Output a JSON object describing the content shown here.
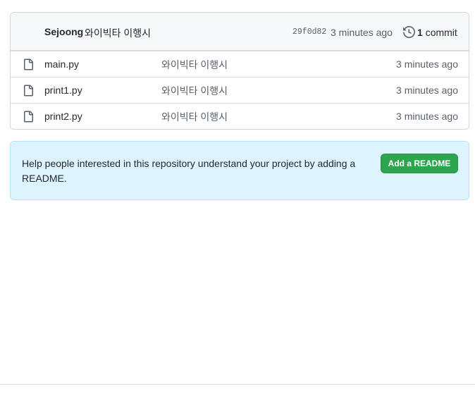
{
  "latest_commit": {
    "author": "Sejoong",
    "message": "와이빅타 이행시",
    "sha": "29f0d82",
    "time": "3 minutes ago",
    "commit_count": "1",
    "commit_label": "commit",
    "history_icon": "history-icon"
  },
  "files": [
    {
      "name": "main.py",
      "message": "와이빅타 이행시",
      "time": "3 minutes ago",
      "icon": "file-icon"
    },
    {
      "name": "print1.py",
      "message": "와이빅타 이행시",
      "time": "3 minutes ago",
      "icon": "file-icon"
    },
    {
      "name": "print2.py",
      "message": "와이빅타 이행시",
      "time": "3 minutes ago",
      "icon": "file-icon"
    }
  ],
  "readme_prompt": {
    "text": "Help people interested in this repository understand your project by adding a README.",
    "button_label": "Add a README"
  },
  "colors": {
    "accent_green": "#2da44e",
    "banner_bg": "#ddf4ff",
    "border": "#d0d7de"
  }
}
